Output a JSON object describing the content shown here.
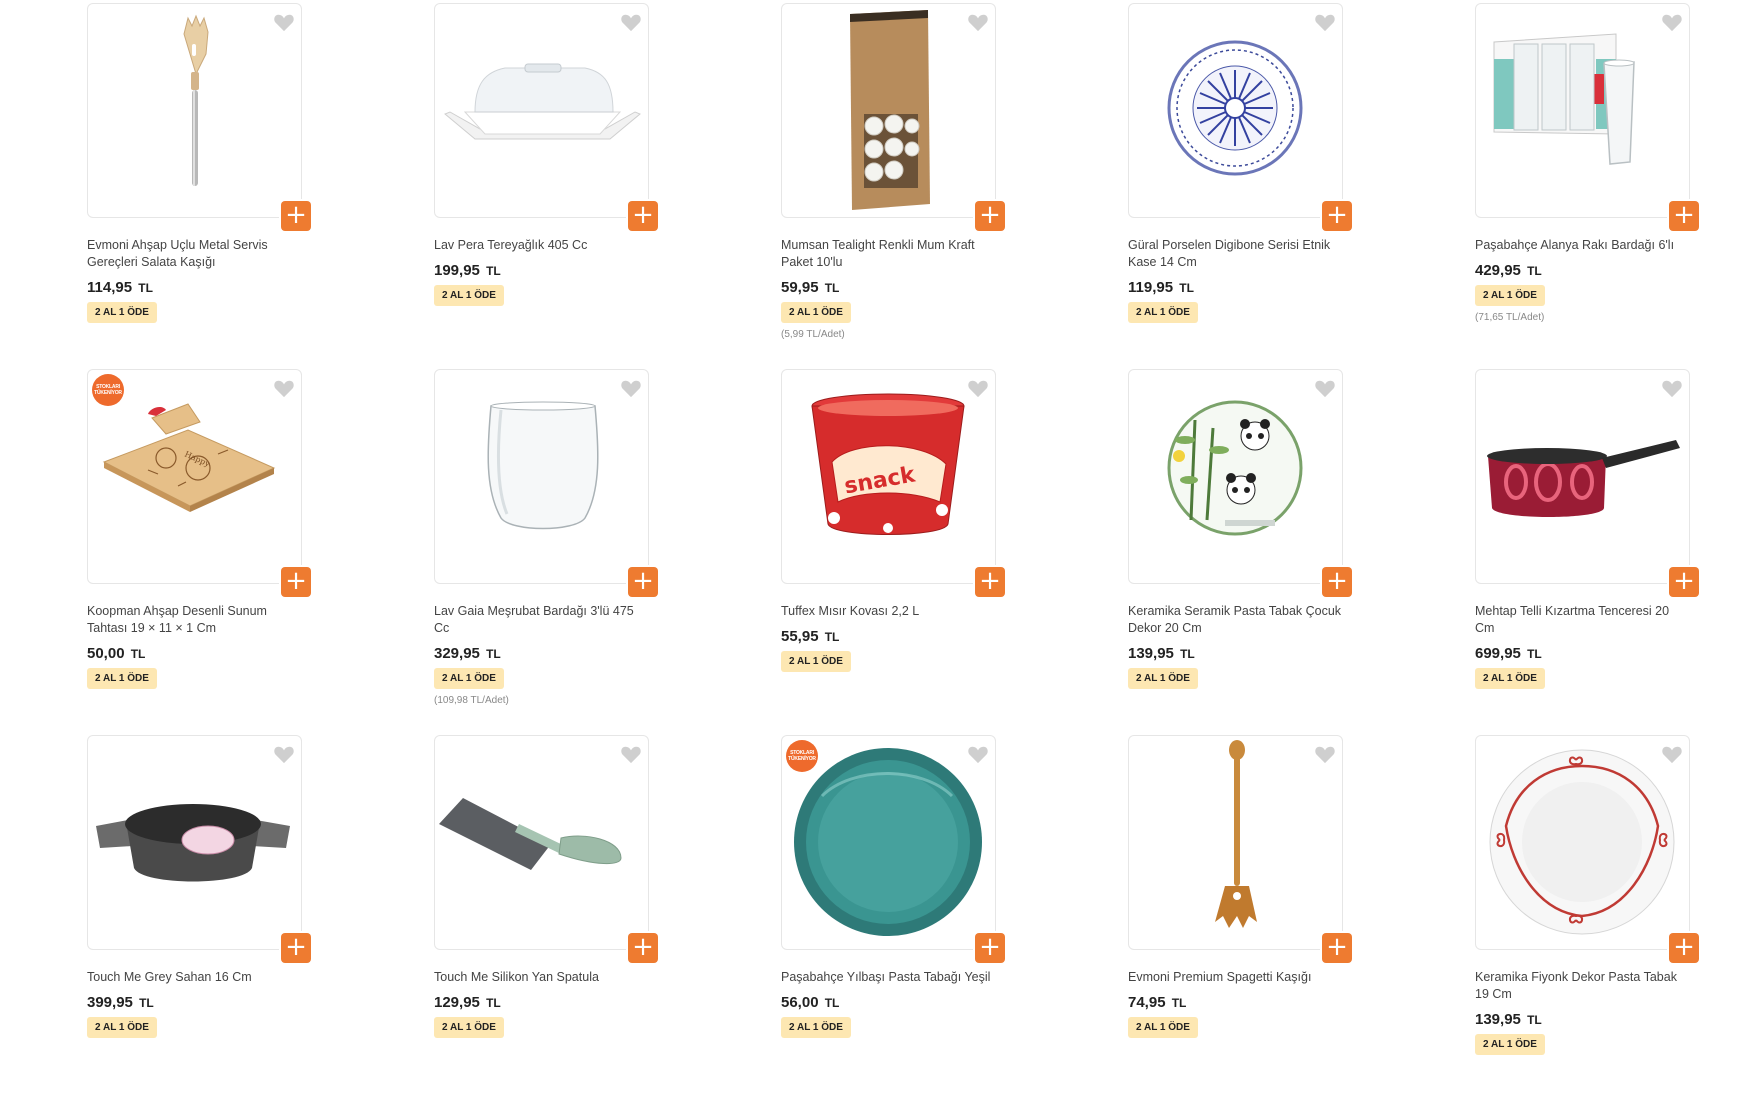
{
  "colors": {
    "accent": "#ee7b30",
    "badge_bg": "#fde7b2",
    "heart": "#cfcfcf"
  },
  "icons": {
    "favorite": "heart-icon",
    "add": "plus-icon"
  },
  "products": [
    {
      "title": "Evmoni Ahşap Uçlu Metal Servis Gereçleri Salata Kaşığı",
      "price": "114,95",
      "currency": "TL",
      "badge": "2 AL 1 ÖDE",
      "unit": "",
      "stock_badge": ""
    },
    {
      "title": "Lav Pera Tereyağlık 405 Cc",
      "price": "199,95",
      "currency": "TL",
      "badge": "2 AL 1 ÖDE",
      "unit": "",
      "stock_badge": ""
    },
    {
      "title": "Mumsan Tealight Renkli Mum Kraft Paket 10'lu",
      "price": "59,95",
      "currency": "TL",
      "badge": "2 AL 1 ÖDE",
      "unit": "(5,99 TL/Adet)",
      "stock_badge": ""
    },
    {
      "title": "Güral Porselen Digibone Serisi Etnik Kase 14 Cm",
      "price": "119,95",
      "currency": "TL",
      "badge": "2 AL 1 ÖDE",
      "unit": "",
      "stock_badge": ""
    },
    {
      "title": "Paşabahçe Alanya Rakı Bardağı 6'lı",
      "price": "429,95",
      "currency": "TL",
      "badge": "2 AL 1 ÖDE",
      "unit": "(71,65 TL/Adet)",
      "stock_badge": ""
    },
    {
      "title": "Koopman Ahşap Desenli Sunum Tahtası 19 × 11 × 1 Cm",
      "price": "50,00",
      "currency": "TL",
      "badge": "2 AL 1 ÖDE",
      "unit": "",
      "stock_badge": "STOKLARI TÜKENİYOR"
    },
    {
      "title": "Lav Gaia Meşrubat Bardağı 3'lü 475 Cc",
      "price": "329,95",
      "currency": "TL",
      "badge": "2 AL 1 ÖDE",
      "unit": "(109,98 TL/Adet)",
      "stock_badge": ""
    },
    {
      "title": "Tuffex Mısır Kovası 2,2 L",
      "price": "55,95",
      "currency": "TL",
      "badge": "2 AL 1 ÖDE",
      "unit": "",
      "stock_badge": ""
    },
    {
      "title": "Keramika Seramik Pasta Tabak Çocuk Dekor 20 Cm",
      "price": "139,95",
      "currency": "TL",
      "badge": "2 AL 1 ÖDE",
      "unit": "",
      "stock_badge": ""
    },
    {
      "title": "Mehtap Telli Kızartma Tenceresi 20 Cm",
      "price": "699,95",
      "currency": "TL",
      "badge": "2 AL 1 ÖDE",
      "unit": "",
      "stock_badge": ""
    },
    {
      "title": "Touch Me Grey Sahan 16 Cm",
      "price": "399,95",
      "currency": "TL",
      "badge": "2 AL 1 ÖDE",
      "unit": "",
      "stock_badge": ""
    },
    {
      "title": "Touch Me Silikon Yan Spatula",
      "price": "129,95",
      "currency": "TL",
      "badge": "2 AL 1 ÖDE",
      "unit": "",
      "stock_badge": ""
    },
    {
      "title": "Paşabahçe Yılbaşı Pasta Tabağı Yeşil",
      "price": "56,00",
      "currency": "TL",
      "badge": "2 AL 1 ÖDE",
      "unit": "",
      "stock_badge": "STOKLARI TÜKENİYOR"
    },
    {
      "title": "Evmoni Premium Spagetti Kaşığı",
      "price": "74,95",
      "currency": "TL",
      "badge": "2 AL 1 ÖDE",
      "unit": "",
      "stock_badge": ""
    },
    {
      "title": "Keramika Fiyonk Dekor Pasta Tabak 19 Cm",
      "price": "139,95",
      "currency": "TL",
      "badge": "2 AL 1 ÖDE",
      "unit": "",
      "stock_badge": ""
    }
  ]
}
